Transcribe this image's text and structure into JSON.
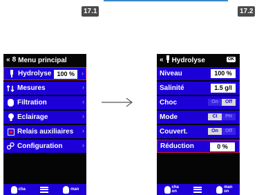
{
  "steps": {
    "left": "17.1",
    "right": "17.2"
  },
  "left_screen": {
    "title": "Menu principal",
    "items": [
      {
        "label": "Hydrolyse",
        "value": "100 %",
        "icon": "hydrolysis-icon",
        "selected": true
      },
      {
        "label": "Mesures",
        "icon": "measures-icon"
      },
      {
        "label": "Filtration",
        "icon": "filtration-icon"
      },
      {
        "label": "Eclairage",
        "icon": "lighting-icon"
      },
      {
        "label": "Relais auxiliaires",
        "icon": "relay-icon"
      },
      {
        "label": "Configuration",
        "icon": "configuration-icon"
      }
    ],
    "bottom": {
      "left": "cha",
      "right": "man"
    }
  },
  "right_screen": {
    "title": "Hydrolyse",
    "ok": "OK",
    "rows": [
      {
        "label": "Niveau",
        "value": "100 %"
      },
      {
        "label": "Salinité",
        "value": "1.5 g/l"
      },
      {
        "label": "Choc",
        "toggle": [
          "On",
          "Off"
        ],
        "active": "Off"
      },
      {
        "label": "Mode",
        "toggle": [
          "CI",
          "PH"
        ],
        "active": "CI"
      },
      {
        "label": "Couvert.",
        "toggle": [
          "On",
          "Off"
        ],
        "active": "On"
      },
      {
        "label": "Réduction",
        "value": "0 %",
        "selected": true
      }
    ],
    "bottom": {
      "left": "cha\non",
      "right": "man\non"
    }
  },
  "colors": {
    "accent": "#1d00d8",
    "highlight": "#e0162b"
  }
}
